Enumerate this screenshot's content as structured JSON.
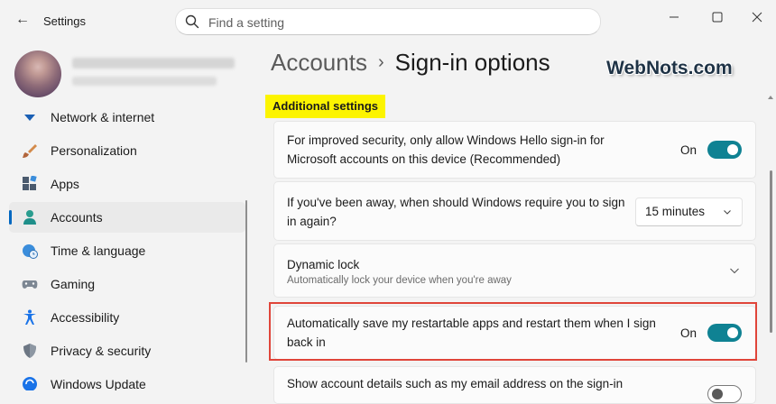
{
  "window": {
    "app_title": "Settings",
    "controls": {
      "minimize": "minimize-icon",
      "maximize": "maximize-icon",
      "close": "close-icon"
    }
  },
  "search": {
    "placeholder": "Find a setting"
  },
  "profile": {
    "name_redacted": true
  },
  "sidebar": {
    "items": [
      {
        "label": "Network & internet",
        "icon": "network-icon",
        "selected": false
      },
      {
        "label": "Personalization",
        "icon": "brush-icon",
        "selected": false
      },
      {
        "label": "Apps",
        "icon": "apps-icon",
        "selected": false
      },
      {
        "label": "Accounts",
        "icon": "person-icon",
        "selected": true
      },
      {
        "label": "Time & language",
        "icon": "globe-clock-icon",
        "selected": false
      },
      {
        "label": "Gaming",
        "icon": "gamepad-icon",
        "selected": false
      },
      {
        "label": "Accessibility",
        "icon": "accessibility-icon",
        "selected": false
      },
      {
        "label": "Privacy & security",
        "icon": "shield-icon",
        "selected": false
      },
      {
        "label": "Windows Update",
        "icon": "update-icon",
        "selected": false
      }
    ]
  },
  "breadcrumb": {
    "parent": "Accounts",
    "separator": "›",
    "current": "Sign-in options"
  },
  "watermark": "WebNots.com",
  "section": {
    "title": "Additional settings",
    "highlight_color": "#fcf400"
  },
  "settings": [
    {
      "text": "For improved security, only allow Windows Hello sign-in for Microsoft accounts on this device (Recommended)",
      "control": "toggle",
      "state_label": "On",
      "on": true
    },
    {
      "text": "If you've been away, when should Windows require you to sign in again?",
      "control": "dropdown",
      "value": "15 minutes"
    },
    {
      "title": "Dynamic lock",
      "description": "Automatically lock your device when you're away",
      "control": "expander"
    },
    {
      "text": "Automatically save my restartable apps and restart them when I sign back in",
      "control": "toggle",
      "state_label": "On",
      "on": true,
      "highlighted": true
    },
    {
      "text": "Show account details such as my email address on the sign-in",
      "control": "toggle",
      "on": false
    }
  ],
  "colors": {
    "accent_toggle": "#0f8293",
    "highlight_border": "#e0453a",
    "selection_indicator": "#0067c0"
  }
}
